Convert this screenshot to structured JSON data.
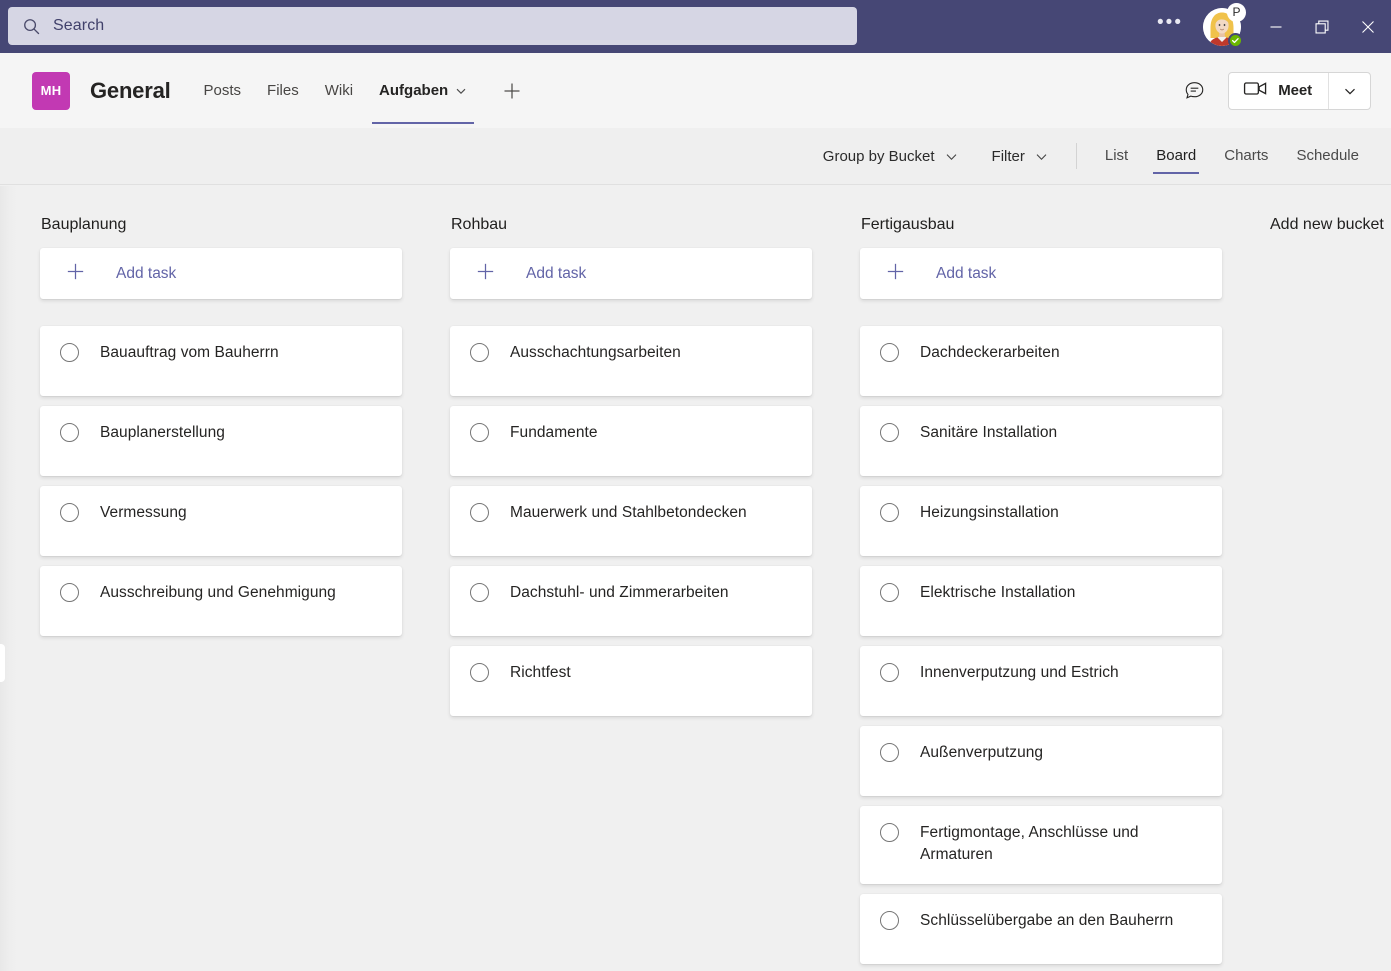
{
  "titlebar": {
    "search": {
      "placeholder": "Search",
      "value": "",
      "icon": "search-icon"
    },
    "more_label": "•••",
    "avatar": {
      "badge": "P",
      "status": "available",
      "status_color": "#6bb700"
    },
    "window_controls": {
      "minimize": "—",
      "maximize": "restore-icon",
      "close": "✕"
    },
    "background_color": "#464775",
    "search_background": "#d6d6e4"
  },
  "channel_header": {
    "team_avatar_initials": "MH",
    "team_avatar_color": "#c239b3",
    "title": "General",
    "tabs": [
      {
        "label": "Posts",
        "active": false
      },
      {
        "label": "Files",
        "active": false
      },
      {
        "label": "Wiki",
        "active": false
      },
      {
        "label": "Aufgaben",
        "active": true,
        "has_chevron": true
      }
    ],
    "add_tab_label": "+",
    "chat_icon": "chat-bubble-icon",
    "meet": {
      "label": "Meet",
      "icon": "video-camera-icon",
      "caret": "chevron-down-icon"
    }
  },
  "planner_toolbar": {
    "group_by": {
      "label": "Group by Bucket",
      "chevron": "chevron-down-icon"
    },
    "filter": {
      "label": "Filter",
      "chevron": "chevron-down-icon"
    },
    "views": [
      {
        "label": "List",
        "active": false
      },
      {
        "label": "Board",
        "active": true
      },
      {
        "label": "Charts",
        "active": false
      },
      {
        "label": "Schedule",
        "active": false
      }
    ],
    "accent_color": "#6264a7"
  },
  "board": {
    "add_task_label": "Add task",
    "add_new_bucket_label": "Add new bucket",
    "buckets": [
      {
        "title": "Bauplanung",
        "tasks": [
          {
            "label": "Bauauftrag vom Bauherrn",
            "completed": false
          },
          {
            "label": "Bauplanerstellung",
            "completed": false
          },
          {
            "label": "Vermessung",
            "completed": false
          },
          {
            "label": "Ausschreibung und Genehmigung",
            "completed": false
          }
        ]
      },
      {
        "title": "Rohbau",
        "tasks": [
          {
            "label": "Ausschachtungsarbeiten",
            "completed": false
          },
          {
            "label": "Fundamente",
            "completed": false
          },
          {
            "label": "Mauerwerk und Stahlbetondecken",
            "completed": false
          },
          {
            "label": "Dachstuhl- und Zimmerarbeiten",
            "completed": false
          },
          {
            "label": "Richtfest",
            "completed": false
          }
        ]
      },
      {
        "title": "Fertigausbau",
        "tasks": [
          {
            "label": "Dachdeckerarbeiten",
            "completed": false
          },
          {
            "label": "Sanitäre Installation",
            "completed": false
          },
          {
            "label": "Heizungsinstallation",
            "completed": false
          },
          {
            "label": "Elektrische Installation",
            "completed": false
          },
          {
            "label": "Innenverputzung und Estrich",
            "completed": false
          },
          {
            "label": "Außenverputzung",
            "completed": false
          },
          {
            "label": "Fertigmontage, Anschlüsse und Armaturen",
            "completed": false
          },
          {
            "label": "Schlüsselübergabe an den Bauherrn",
            "completed": false
          }
        ]
      }
    ]
  }
}
